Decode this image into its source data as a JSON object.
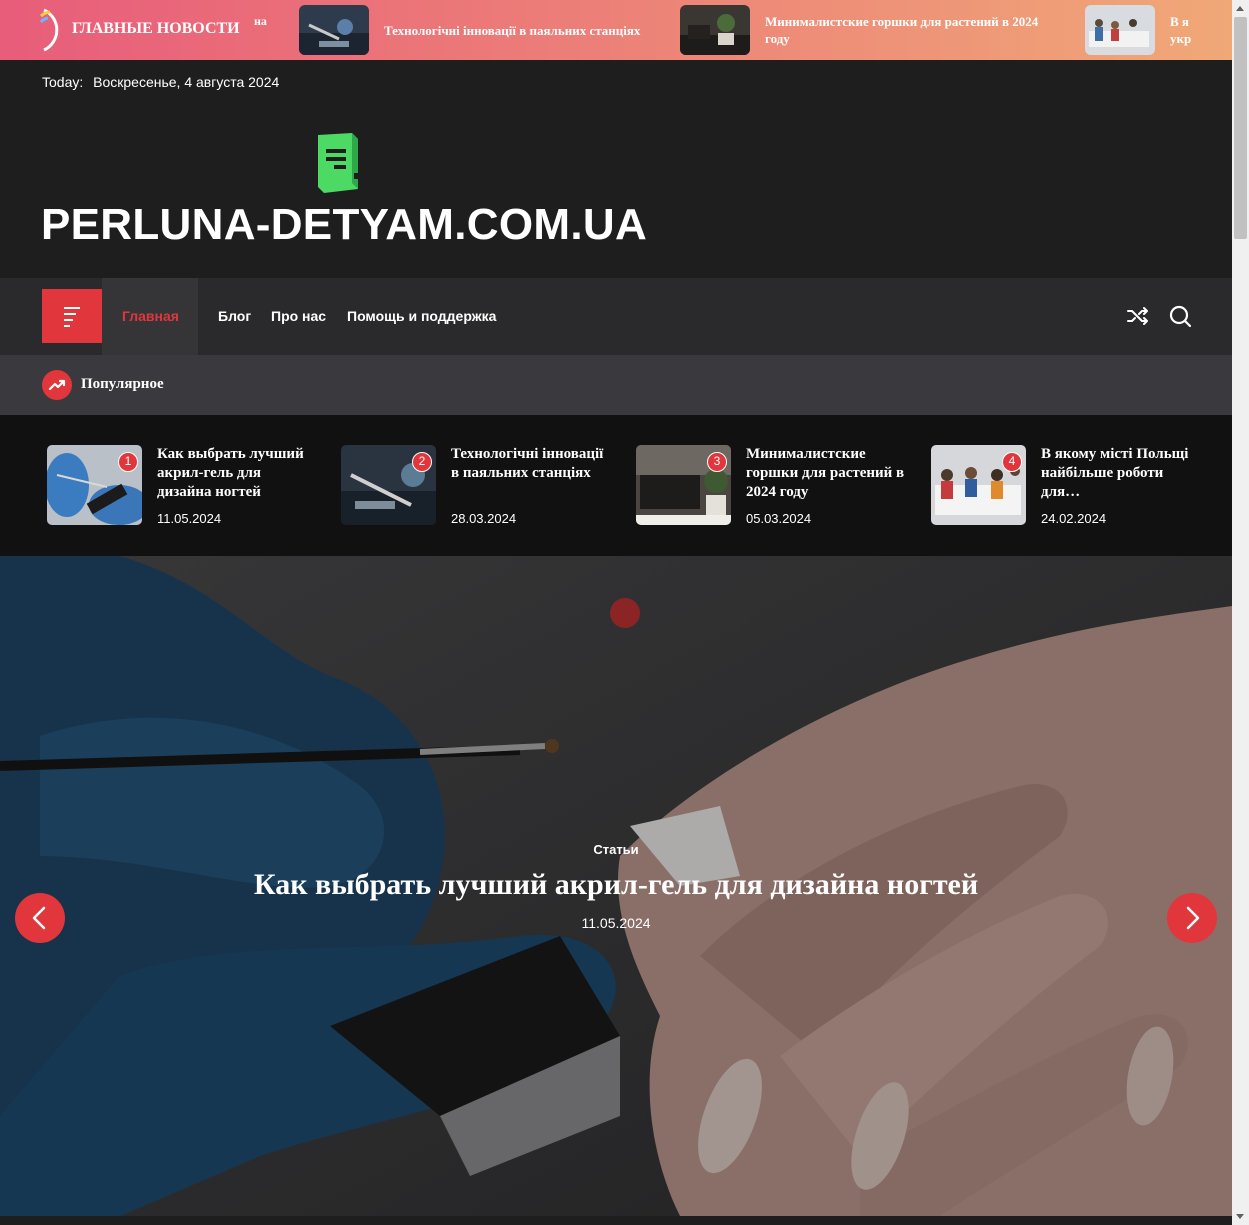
{
  "ticker": {
    "title": "ГЛАВНЫЕ НОВОСТИ",
    "fragment": "на",
    "items": [
      {
        "text": "Технологічні інновації в паяльних станціях",
        "thumb": "soldering"
      },
      {
        "text": "Минималистские горшки для растений в 2024 году",
        "thumb": "room"
      },
      {
        "text": "В я укр",
        "thumb": "office"
      }
    ]
  },
  "topline": {
    "label": "Today:",
    "date": "Воскресенье, 4 августа 2024"
  },
  "site": {
    "title": "PERLUNA-DETYAM.COM.UA",
    "icon": "book-icon",
    "icon_color": "#4cd964"
  },
  "nav": {
    "items": [
      {
        "label": "Главная",
        "active": true
      },
      {
        "label": "Блог"
      },
      {
        "label": "Про нас"
      },
      {
        "label": "Помощь и поддержка"
      }
    ],
    "accent": "#e0363c"
  },
  "popular": {
    "label": "Популярное",
    "items": [
      {
        "num": "1",
        "title": "Как выбрать лучший акрил-гель для дизайна ногтей",
        "date": "11.05.2024"
      },
      {
        "num": "2",
        "title": "Технологічні інновації в паяльних станціях",
        "date": "28.03.2024"
      },
      {
        "num": "3",
        "title": "Минималистские горшки для растений в 2024 году",
        "date": "05.03.2024"
      },
      {
        "num": "4",
        "title": "В якому місті Польщі найбільше роботи для…",
        "date": "24.02.2024"
      }
    ]
  },
  "hero": {
    "category": "Статьи",
    "title": "Как выбрать лучший акрил-гель для дизайна ногтей",
    "date": "11.05.2024"
  }
}
